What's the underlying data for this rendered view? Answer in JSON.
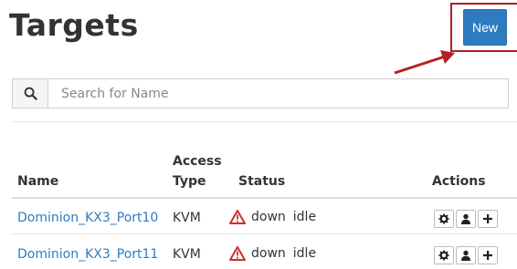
{
  "page": {
    "title": "Targets"
  },
  "toolbar": {
    "new_label": "New"
  },
  "search": {
    "placeholder": "Search for Name",
    "value": ""
  },
  "table": {
    "headers": {
      "name": "Name",
      "access_line1": "Access",
      "access_line2": "Type",
      "status": "Status",
      "actions": "Actions"
    },
    "rows": [
      {
        "name": "Dominion_KX3_Port10",
        "access_type": "KVM",
        "status": "down",
        "state": "idle"
      },
      {
        "name": "Dominion_KX3_Port11",
        "access_type": "KVM",
        "status": "down",
        "state": "idle"
      }
    ]
  },
  "icons": {
    "search": "search-icon",
    "warning": "warning-triangle-icon",
    "settings": "gear-icon",
    "user": "user-icon",
    "add": "plus-icon"
  },
  "colors": {
    "accent": "#2f7bbf",
    "warning": "#c9302c",
    "highlight": "#b51e24"
  }
}
